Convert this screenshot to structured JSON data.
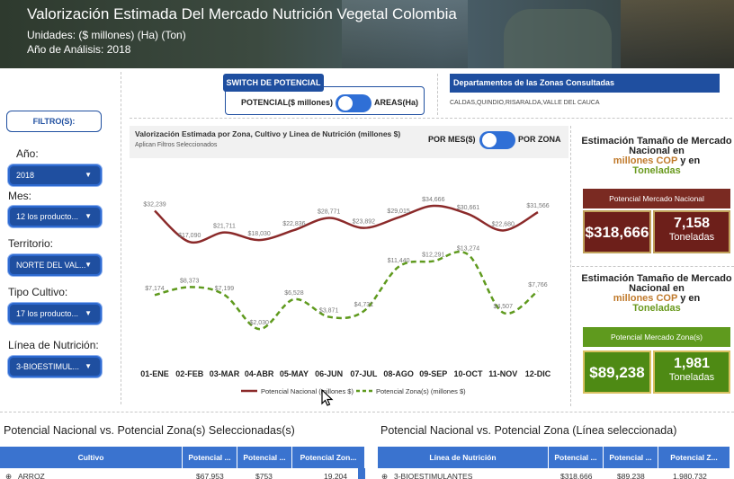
{
  "header": {
    "title": "Valorización Estimada Del Mercado Nutrición Vegetal Colombia",
    "units": "Unidades: ($ millones) (Ha) (Ton)",
    "year": "Año de Análisis: 2018"
  },
  "switch": {
    "title": "SWITCH DE POTENCIAL",
    "left_label": "POTENCIAL($ millones)",
    "right_label": "AREAS(Ha)"
  },
  "departments": {
    "title": "Departamentos de las Zonas Consultadas",
    "value": "CALDAS,QUINDIO,RISARALDA,VALLE DEL CAUCA"
  },
  "filters": {
    "button": "FILTRO(S):",
    "items": [
      {
        "label": "Año:",
        "value": "2018"
      },
      {
        "label": "Mes:",
        "value": "12 los producto..."
      },
      {
        "label": "Territorio:",
        "value": "NORTE DEL VAL..."
      },
      {
        "label": "Tipo Cultivo:",
        "value": "17 los producto..."
      },
      {
        "label": "Línea de Nutrición:",
        "value": "3-BIOESTIMUL..."
      }
    ]
  },
  "chart_panel": {
    "title": "Valorización Estimada por Zona, Cultivo y Linea de Nutrición (millones $)",
    "subtitle": "Aplican Filtros Seleccionados",
    "toggle_left": "POR MES($)",
    "toggle_right": "POR ZONA"
  },
  "chart_data": {
    "type": "line",
    "categories": [
      "01-ENE",
      "02-FEB",
      "03-MAR",
      "04-ABR",
      "05-MAY",
      "06-JUN",
      "07-JUL",
      "08-AGO",
      "09-SEP",
      "10-OCT",
      "11-NOV",
      "12-DIC"
    ],
    "series": [
      {
        "name": "Potencial Nacional (millones $)",
        "color": "#8b2a2a",
        "dash": false,
        "values": [
          32239,
          17090,
          21711,
          18030,
          22836,
          28771,
          23892,
          29015,
          34666,
          30661,
          22680,
          31566
        ],
        "labels": [
          "$32,239",
          "$17,090",
          "$21,711",
          "$18,030",
          "$22,836",
          "$28,771",
          "$23,892",
          "$29,015",
          "$34,666",
          "$30,661",
          "$22,680",
          "$31,566"
        ]
      },
      {
        "name": "Potencial Zona(s) (millones $)",
        "color": "#5f9a1e",
        "dash": true,
        "values": [
          7174,
          8373,
          7199,
          2030,
          6528,
          3871,
          4731,
          11440,
          12291,
          13274,
          4507,
          7766
        ],
        "labels": [
          "$7,174",
          "$8,373",
          "$7,199",
          "$2,030",
          "$6,528",
          "$3,871",
          "$4,731",
          "$11,440",
          "$12,291",
          "$13,274",
          "$4,507",
          "$7,766"
        ]
      }
    ]
  },
  "kpi_nacional": {
    "title_a": "Estimación Tamaño de Mercado Nacional en",
    "title_cop": "millones COP",
    "title_y": "y en",
    "title_ton": "Toneladas",
    "header": "Potencial Mercado Nacional",
    "value": "$318,666",
    "tons": "7,158",
    "tons_label": "Toneladas",
    "color": "#7a2a22"
  },
  "kpi_zona": {
    "title_a": "Estimación Tamaño de Mercado Nacional en",
    "title_cop": "millones COP",
    "title_y": "y en",
    "title_ton": "Toneladas",
    "header": "Potencial Mercado Zona(s)",
    "value": "$89,238",
    "tons": "1,981",
    "tons_label": "Toneladas",
    "color": "#5f9a1e"
  },
  "table_left": {
    "title": "Potencial Nacional vs. Potencial Zona(s) Seleccionadas(s)",
    "columns": [
      "Cultivo",
      "Potencial ...",
      "Potencial ...",
      "Potencial Zon..."
    ],
    "row": [
      "ARROZ",
      "$67,953",
      "$753",
      "19,204"
    ]
  },
  "table_right": {
    "title": "Potencial Nacional vs. Potencial Zona (Línea seleccionada)",
    "columns": [
      "Línea de Nutrición",
      "Potencial ...",
      "Potencial ...",
      "Potencial Z..."
    ],
    "row": [
      "3-BIOESTIMULANTES",
      "$318,666",
      "$89,238",
      "1,980,732"
    ]
  }
}
